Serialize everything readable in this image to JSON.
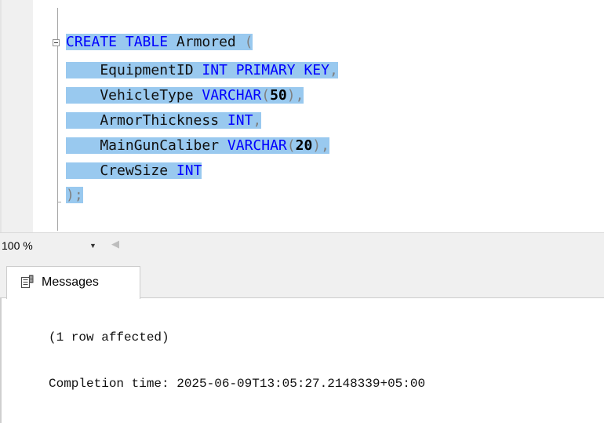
{
  "editor": {
    "lines": [
      [
        {
          "text": "CREATE",
          "kind": "kw"
        },
        {
          "text": " ",
          "kind": "ident"
        },
        {
          "text": "TABLE",
          "kind": "kw"
        },
        {
          "text": " Armored ",
          "kind": "ident"
        },
        {
          "text": "(",
          "kind": "gr"
        }
      ],
      [
        {
          "text": "    EquipmentID ",
          "kind": "ident"
        },
        {
          "text": "INT",
          "kind": "kw"
        },
        {
          "text": " ",
          "kind": "ident"
        },
        {
          "text": "PRIMARY",
          "kind": "kw"
        },
        {
          "text": " ",
          "kind": "ident"
        },
        {
          "text": "KEY",
          "kind": "kw"
        },
        {
          "text": ",",
          "kind": "gr"
        }
      ],
      [
        {
          "text": "    VehicleType ",
          "kind": "ident"
        },
        {
          "text": "VARCHAR",
          "kind": "kw"
        },
        {
          "text": "(",
          "kind": "gr"
        },
        {
          "text": "50",
          "kind": "num"
        },
        {
          "text": "),",
          "kind": "gr"
        }
      ],
      [
        {
          "text": "    ArmorThickness ",
          "kind": "ident"
        },
        {
          "text": "INT",
          "kind": "kw"
        },
        {
          "text": ",",
          "kind": "gr"
        }
      ],
      [
        {
          "text": "    MainGunCaliber ",
          "kind": "ident"
        },
        {
          "text": "VARCHAR",
          "kind": "kw"
        },
        {
          "text": "(",
          "kind": "gr"
        },
        {
          "text": "20",
          "kind": "num"
        },
        {
          "text": "),",
          "kind": "gr"
        }
      ],
      [
        {
          "text": "    CrewSize ",
          "kind": "ident"
        },
        {
          "text": "INT",
          "kind": "kw"
        }
      ],
      [
        {
          "text": ");",
          "kind": "gr"
        }
      ]
    ]
  },
  "zoom": {
    "value": "100 %",
    "arrow": "▼",
    "scroll_left": "◀"
  },
  "results": {
    "tab_label": "Messages",
    "messages": [
      "(1 row affected)",
      "Completion time: 2025-06-09T13:05:27.2148339+05:00"
    ]
  },
  "icons": {
    "collapse": "collapse-minus-icon",
    "messages_tab": "messages-icon"
  },
  "colors": {
    "keyword": "#0000ff",
    "punctuation": "#808080",
    "selection": "#99c9ef",
    "margin": "#f0f0f0"
  }
}
